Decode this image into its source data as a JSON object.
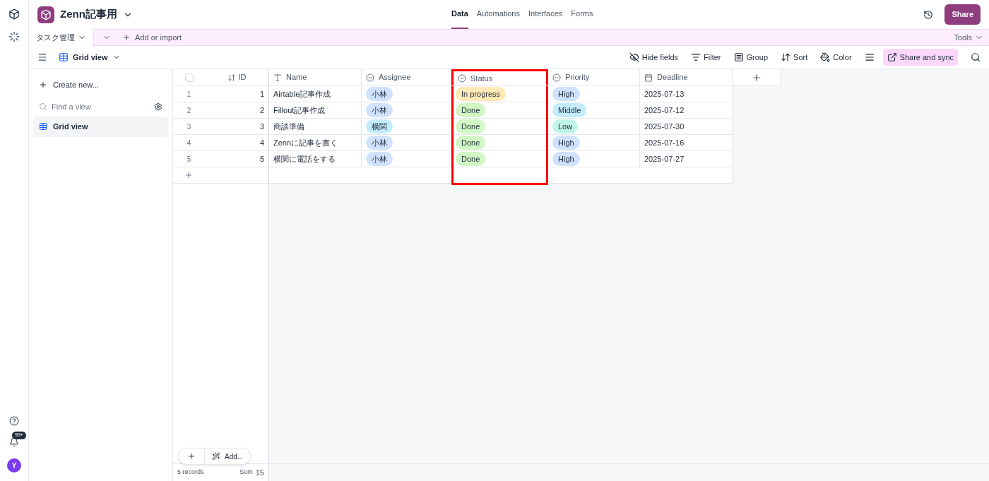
{
  "base": {
    "name": "Zenn記事用"
  },
  "nav_tabs": [
    {
      "label": "Data",
      "selected": true
    },
    {
      "label": "Automations",
      "selected": false
    },
    {
      "label": "Interfaces",
      "selected": false
    },
    {
      "label": "Forms",
      "selected": false
    }
  ],
  "share_button": "Share",
  "table_tabs": [
    {
      "label": "タスク管理",
      "selected": true
    }
  ],
  "add_or_import": "Add or import",
  "tools": "Tools",
  "view_selector": "Grid view",
  "toolbar": [
    {
      "kind": "hide",
      "label": "Hide fields"
    },
    {
      "kind": "filter",
      "label": "Filter"
    },
    {
      "kind": "group",
      "label": "Group"
    },
    {
      "kind": "sort",
      "label": "Sort"
    },
    {
      "kind": "color",
      "label": "Color"
    },
    {
      "kind": "height"
    },
    {
      "kind": "share",
      "label": "Share and sync"
    }
  ],
  "sidebar": {
    "create": "Create new...",
    "search_placeholder": "Find a view",
    "views": [
      {
        "label": "Grid view",
        "selected": true
      }
    ]
  },
  "notifications_badge": "99+",
  "avatar": "Y",
  "table": {
    "all_selected": false,
    "columns": [
      {
        "label": "ID",
        "kind": "number",
        "highlighted": false
      },
      {
        "label": "Name",
        "kind": "text",
        "highlighted": false
      },
      {
        "label": "Assignee",
        "kind": "select",
        "highlighted": false
      },
      {
        "label": "Status",
        "kind": "select",
        "highlighted": true
      },
      {
        "label": "Priority",
        "kind": "select",
        "highlighted": false
      },
      {
        "label": "Deadline",
        "kind": "date",
        "highlighted": false
      }
    ],
    "rows": [
      {
        "index": "1",
        "cells": [
          {
            "text": "1"
          },
          {
            "text": "Airtable記事作成"
          },
          {
            "text": "小林",
            "color": "#d1e2ff"
          },
          {
            "text": "In progress",
            "color": "#ffeab6"
          },
          {
            "text": "High",
            "color": "#d1e2ff"
          },
          {
            "text": "2025-07-13"
          }
        ]
      },
      {
        "index": "2",
        "cells": [
          {
            "text": "2"
          },
          {
            "text": "Fillout記事作成"
          },
          {
            "text": "小林",
            "color": "#d1e2ff"
          },
          {
            "text": "Done",
            "color": "#d1f7c4"
          },
          {
            "text": "Middle",
            "color": "#c4ecff"
          },
          {
            "text": "2025-07-12"
          }
        ]
      },
      {
        "index": "3",
        "cells": [
          {
            "text": "3"
          },
          {
            "text": "商談準備"
          },
          {
            "text": "横関",
            "color": "#c4ecff"
          },
          {
            "text": "Done",
            "color": "#d1f7c4"
          },
          {
            "text": "Low",
            "color": "#c2f5e9"
          },
          {
            "text": "2025-07-30"
          }
        ]
      },
      {
        "index": "4",
        "cells": [
          {
            "text": "4"
          },
          {
            "text": "Zennに記事を書く"
          },
          {
            "text": "小林",
            "color": "#d1e2ff"
          },
          {
            "text": "Done",
            "color": "#d1f7c4"
          },
          {
            "text": "High",
            "color": "#d1e2ff"
          },
          {
            "text": "2025-07-16"
          }
        ]
      },
      {
        "index": "5",
        "cells": [
          {
            "text": "5"
          },
          {
            "text": "横関に電話をする"
          },
          {
            "text": "小林",
            "color": "#d1e2ff"
          },
          {
            "text": "Done",
            "color": "#d1f7c4"
          },
          {
            "text": "High",
            "color": "#d1e2ff"
          },
          {
            "text": "2025-07-27"
          }
        ]
      }
    ],
    "add_menu": "Add...",
    "footer": {
      "records": "5 records",
      "sum_label": "Sum",
      "sum_value": "15"
    }
  }
}
